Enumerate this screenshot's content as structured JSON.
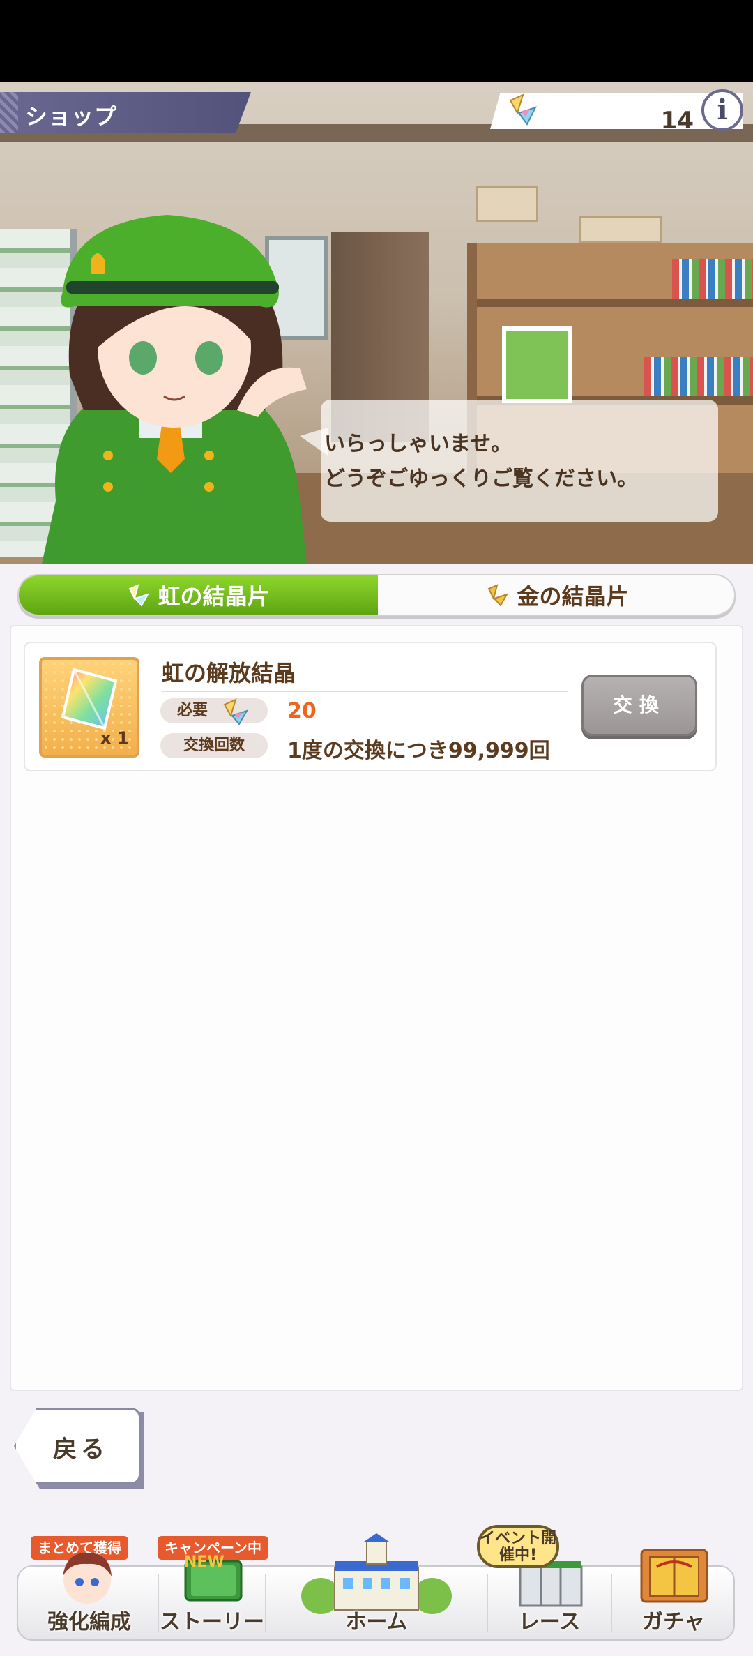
{
  "header": {
    "title": "ショップ",
    "currency_value": "14",
    "info_label": "i"
  },
  "speech": {
    "line1": "いらっしゃいませ。",
    "line2": "どうぞごゆっくりご覧ください。"
  },
  "tabs": [
    {
      "label": "虹の結晶片",
      "active": true
    },
    {
      "label": "金の結晶片",
      "active": false
    }
  ],
  "item": {
    "name": "虹の解放結晶",
    "quantity": "x 1",
    "required_label": "必要",
    "required_value": "20",
    "limit_label": "交換回数",
    "limit_value": "1度の交換につき99,999回",
    "exchange_label": "交換"
  },
  "back_label": "戻る",
  "nav": [
    {
      "label": "強化編成",
      "badge": "まとめて獲得"
    },
    {
      "label": "ストーリー",
      "badge": "キャンペーン中"
    },
    {
      "label": "ホーム",
      "badge": ""
    },
    {
      "label": "レース",
      "badge": "イベント開催中!"
    },
    {
      "label": "ガチャ",
      "badge": ""
    }
  ],
  "colors": {
    "tab_active": "#6cb81b",
    "required_value": "#f0641e",
    "title_plate": "#5a5880"
  }
}
